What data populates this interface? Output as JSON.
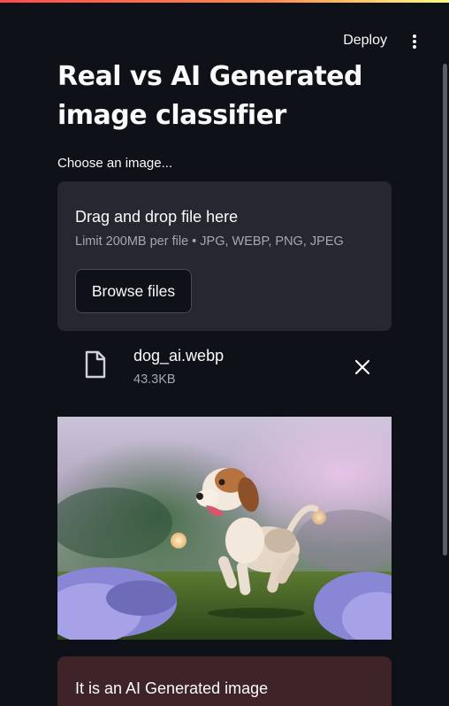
{
  "toolbar": {
    "deploy_label": "Deploy",
    "menu_icon": "more-vertical-icon"
  },
  "page": {
    "title": "Real vs AI Generated image classifier"
  },
  "uploader": {
    "label": "Choose an image...",
    "drag_text": "Drag and drop file here",
    "limit_text": "Limit 200MB per file • JPG, WEBP, PNG, JPEG",
    "browse_label": "Browse files"
  },
  "file": {
    "icon": "file-icon",
    "name": "dog_ai.webp",
    "size": "43.3KB",
    "remove_icon": "close-icon"
  },
  "preview": {
    "subject": "beagle puppy running on grass with purple flowers"
  },
  "result": {
    "text": "It is an AI Generated image"
  },
  "colors": {
    "background": "#0e1117",
    "dropzone": "#262730",
    "result_background": "#3e2428",
    "text": "#fafafa",
    "muted_text": "#a3a8b4",
    "accent_gradient_start": "#ff4b4b",
    "accent_gradient_end": "#fffd80"
  }
}
